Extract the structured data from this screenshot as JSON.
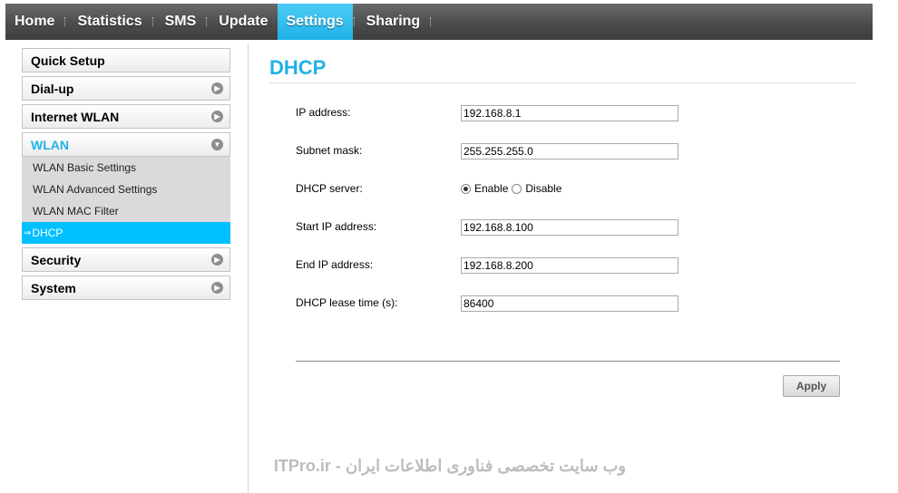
{
  "nav": {
    "items": [
      {
        "label": "Home",
        "active": false
      },
      {
        "label": "Statistics",
        "active": false
      },
      {
        "label": "SMS",
        "active": false
      },
      {
        "label": "Update",
        "active": false
      },
      {
        "label": "Settings",
        "active": true
      },
      {
        "label": "Sharing",
        "active": false
      }
    ]
  },
  "sidebar": {
    "quick_setup": "Quick Setup",
    "dialup": "Dial-up",
    "internet_wlan": "Internet WLAN",
    "wlan": "WLAN",
    "wlan_sub": {
      "basic": "WLAN Basic Settings",
      "advanced": "WLAN Advanced Settings",
      "mac_filter": "WLAN MAC Filter",
      "dhcp": "DHCP",
      "active_arrow": "⇒"
    },
    "security": "Security",
    "system": "System"
  },
  "main": {
    "title": "DHCP",
    "ip_label": "IP address:",
    "ip_value": "192.168.8.1",
    "mask_label": "Subnet mask:",
    "mask_value": "255.255.255.0",
    "server_label": "DHCP server:",
    "enable_label": "Enable",
    "disable_label": "Disable",
    "server_enabled": true,
    "start_label": "Start IP address:",
    "start_value": "192.168.8.100",
    "end_label": "End IP address:",
    "end_value": "192.168.8.200",
    "lease_label": "DHCP lease time (s):",
    "lease_value": "86400",
    "apply_label": "Apply"
  },
  "watermark": "ITPro.ir - وب سایت تخصصی فناوری اطلاعات ایران",
  "colors": {
    "accent": "#1fb2e8",
    "active_sub_bg": "#00c0ff",
    "nav_bg": "#4a4a4a"
  },
  "icons": {
    "collapsed": "chevron-right-circle-icon",
    "expanded": "chevron-down-circle-icon"
  }
}
